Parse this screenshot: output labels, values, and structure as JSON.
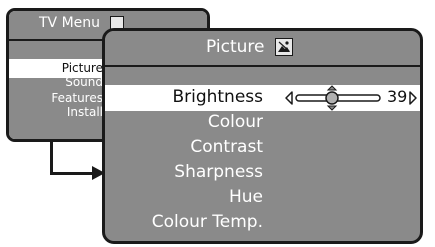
{
  "tv_menu": {
    "title": "TV Menu",
    "items": [
      "Picture",
      "Sound",
      "Features",
      "Install"
    ],
    "active_item": "Picture"
  },
  "picture_menu": {
    "title": "Picture",
    "items": [
      "Brightness",
      "Colour",
      "Contrast",
      "Sharpness",
      "Hue",
      "Colour Temp."
    ],
    "active_item": "Brightness",
    "brightness_value": "39"
  },
  "icons": {
    "tv_menu_title_icon": "menu-card-icon",
    "picture_title_icon": "picture-icon",
    "left_arrow": "slider-left-arrow-icon",
    "right_arrow": "slider-right-arrow-icon",
    "slider_knob": "slider-knob-icon"
  },
  "colors": {
    "panel_gray": "#8a8a8a",
    "highlight": "#ffffff",
    "border": "#1a1a1a",
    "text_inactive": "#ffffff",
    "text_active": "#111111"
  }
}
